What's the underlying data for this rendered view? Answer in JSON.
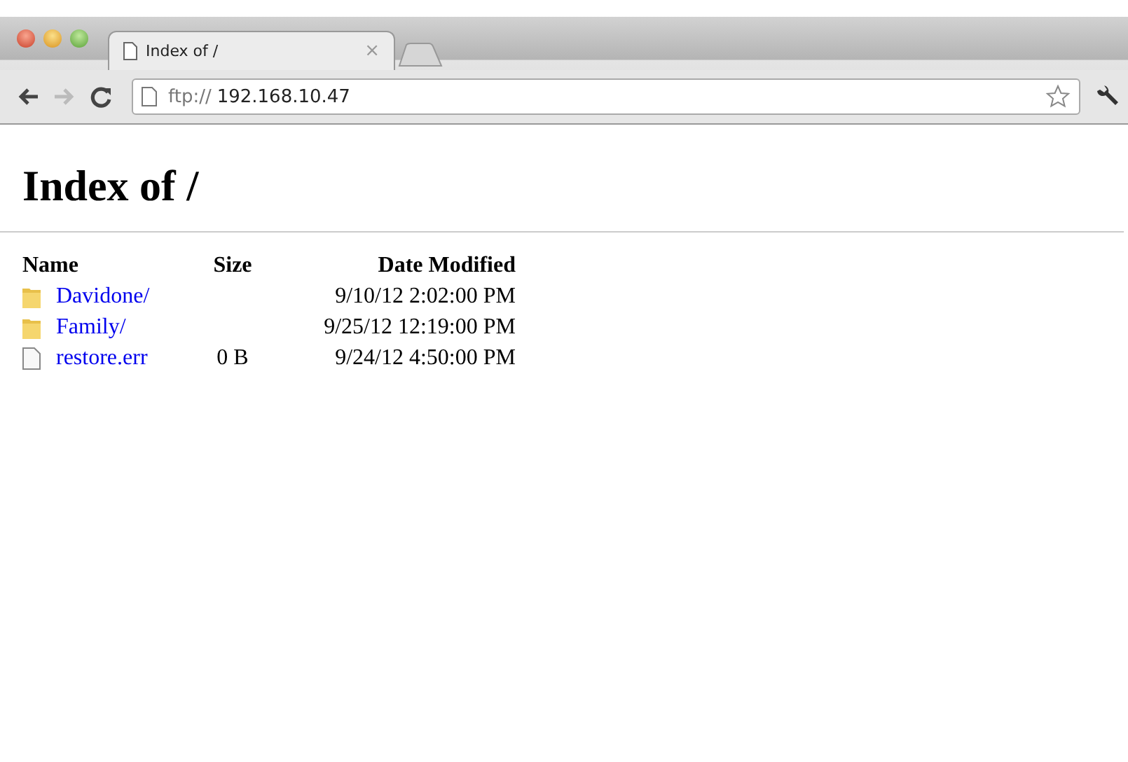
{
  "tab": {
    "title": "Index of /",
    "close": "×"
  },
  "address": {
    "scheme": "ftp://",
    "host": "192.168.10.47"
  },
  "page": {
    "heading": "Index of /",
    "columns": [
      "Name",
      "Size",
      "Date Modified"
    ],
    "rows": [
      {
        "kind": "folder",
        "name": "Davidone/",
        "size": "",
        "date": "9/10/12 2:02:00 PM"
      },
      {
        "kind": "folder",
        "name": "Family/",
        "size": "",
        "date": "9/25/12 12:19:00 PM"
      },
      {
        "kind": "file",
        "name": "restore.err",
        "size": "0 B",
        "date": "9/24/12 4:50:00 PM"
      }
    ]
  }
}
